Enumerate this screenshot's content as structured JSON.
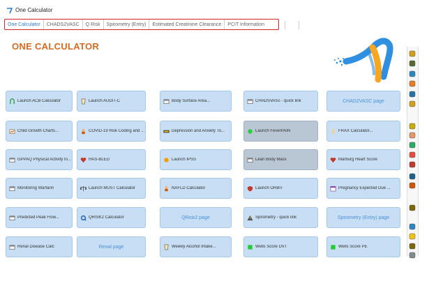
{
  "window": {
    "title": "One Calculator"
  },
  "tabs": [
    {
      "label": "One Calculator",
      "active": true
    },
    {
      "label": "CHADS2VASC",
      "active": false
    },
    {
      "label": "Q Risk",
      "active": false
    },
    {
      "label": "Spirometry (Entry)",
      "active": false
    },
    {
      "label": "Estimated Creatinine Clearance",
      "active": false
    },
    {
      "label": "PCIT Information",
      "active": false
    }
  ],
  "header": {
    "title": "ONE CALCULATOR",
    "accent_color": "#d86a1f"
  },
  "tiles": [
    {
      "label": "Launch ACB Calculator",
      "icon": "arch-icon"
    },
    {
      "label": "Launch AUDIT-C",
      "icon": "glass-icon"
    },
    {
      "label": "Body Surface Area...",
      "icon": "window-icon"
    },
    {
      "label": "CHADSVASc - quick link",
      "icon": "window-icon"
    },
    {
      "label": "CHAD2VASC page",
      "icon": ""
    },
    {
      "label": "Child Growth Charts...",
      "icon": "chart-icon"
    },
    {
      "label": "COVID-19 Risk Coding and ...",
      "icon": "person-icon"
    },
    {
      "label": "Depression and Anxiety To...",
      "icon": "dash-icon"
    },
    {
      "label": "Launch FeverPAIN",
      "icon": "green-dot-icon"
    },
    {
      "label": "FRAX Calculator...",
      "icon": "bone-icon"
    },
    {
      "label": "GPPAQ Physical Activity In...",
      "icon": "window-icon"
    },
    {
      "label": "HAS-BLED",
      "icon": "heart-icon"
    },
    {
      "label": "Launch IPSS",
      "icon": "orange-dot-icon"
    },
    {
      "label": "Lean Body Mass",
      "icon": "window-icon"
    },
    {
      "label": "Marburg Heart Score",
      "icon": "heart-icon"
    },
    {
      "label": "Monitoring Warfarin",
      "icon": "window-icon"
    },
    {
      "label": "Launch MUST Calculator",
      "icon": "scale-icon"
    },
    {
      "label": "NAFLD Calculator",
      "icon": "person-icon"
    },
    {
      "label": "Launch ORBIT",
      "icon": "shield-icon"
    },
    {
      "label": "Pregnancy Expected Due ...",
      "icon": "calendar-icon"
    },
    {
      "label": "Predicted Peak Flow...",
      "icon": "window-icon"
    },
    {
      "label": "QRISK2 Calculator",
      "icon": "q-icon"
    },
    {
      "label": "QRisk2 page",
      "icon": ""
    },
    {
      "label": "Spirometry - quick link",
      "icon": "warning-icon"
    },
    {
      "label": "Spirometry (Entry) page",
      "icon": ""
    },
    {
      "label": "Renal Disease Calc",
      "icon": "window-icon"
    },
    {
      "label": "Renal page",
      "icon": ""
    },
    {
      "label": "Weekly Alcohol Intake...",
      "icon": "glass-icon"
    },
    {
      "label": "Wells Score DVT",
      "icon": "green-square-icon"
    },
    {
      "label": "Wells Score PE",
      "icon": "green-square-icon"
    }
  ],
  "side_icons": [
    "smiley-icon",
    "stack-icon",
    "chart-icon",
    "folder-icon",
    "search-icon",
    "smiley-icon",
    "face-icon",
    "face-icon",
    "bar-chart-icon",
    "star-icon",
    "pin-icon",
    "gear-icon",
    "person-icon",
    "book-icon",
    "star-icon",
    "star-icon",
    "book-icon",
    "disk-icon"
  ]
}
